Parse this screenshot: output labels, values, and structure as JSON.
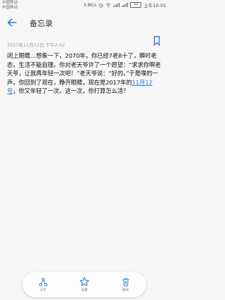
{
  "status_bar": {
    "carrier_1": "中国移动",
    "carrier_2": "中国移动",
    "network_speed": "3.8K/s",
    "battery": "52",
    "time": "上午10:55"
  },
  "header": {
    "title": "备忘录"
  },
  "note": {
    "date": "2017年11月12日 下午2:42",
    "body_before_link": "闭上眼睛…想象一下，2070年，你已经7老8十了，瞬时老态，生活不能自理。你对老天爷许了一个愿望：“求求你啊老天爷，让我再年轻一次吧！”老天爷说：“好的。”于是噗的一声，你回到了现在，睁开眼睛，现在是2017年的",
    "link_text": "11月12号",
    "body_after_link": "，你又年轻了一次。这一次，你打算怎么活？"
  },
  "bottom_bar": {
    "share_label": "分享",
    "favorite_label": "收藏",
    "delete_label": "删除"
  },
  "colors": {
    "accent": "#2f7fd8",
    "background": "#f6f6f6"
  }
}
